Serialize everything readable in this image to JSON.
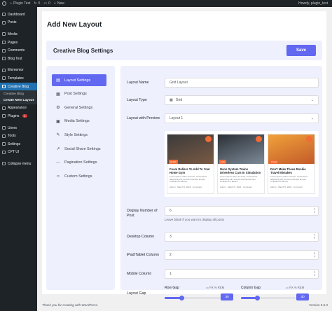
{
  "admin_bar": {
    "site_name": "Plugin Test",
    "updates": "5",
    "comments": "0",
    "new_label": "New",
    "greeting": "Howdy, plugin_test"
  },
  "sidebar": {
    "items": [
      {
        "label": "Dashboard",
        "icon": "dashboard-icon"
      },
      {
        "label": "Posts",
        "icon": "pin-icon"
      },
      {
        "label": "Media",
        "icon": "media-icon"
      },
      {
        "label": "Pages",
        "icon": "page-icon"
      },
      {
        "label": "Comments",
        "icon": "comment-icon"
      },
      {
        "label": "Blog Test",
        "icon": "pin-icon"
      },
      {
        "label": "Elementor",
        "icon": "elementor-icon"
      },
      {
        "label": "Templates",
        "icon": "folder-icon"
      },
      {
        "label": "Creative Blog",
        "icon": "blog-icon",
        "active": true
      }
    ],
    "submenu": [
      "Creative Blog",
      "Create New Layout"
    ],
    "items_after": [
      {
        "label": "Appearance",
        "icon": "brush-icon"
      },
      {
        "label": "Plugins",
        "icon": "plugin-icon",
        "badge": "1"
      },
      {
        "label": "Users",
        "icon": "user-icon"
      },
      {
        "label": "Tools",
        "icon": "wrench-icon"
      },
      {
        "label": "Settings",
        "icon": "settings-icon"
      },
      {
        "label": "CPT UI",
        "icon": "cpt-icon"
      },
      {
        "label": "Collapse menu",
        "icon": "collapse-icon"
      }
    ]
  },
  "page": {
    "title": "Add New Layout"
  },
  "header": {
    "title": "Creative Blog Settings",
    "save_label": "Save"
  },
  "tabs": [
    {
      "label": "Layout Settings",
      "icon": "layout-icon",
      "active": true
    },
    {
      "label": "Post Settings",
      "icon": "grid-icon"
    },
    {
      "label": "General Settings",
      "icon": "gear-icon"
    },
    {
      "label": "Media Settings",
      "icon": "media-icon"
    },
    {
      "label": "Style Settings",
      "icon": "brush-icon"
    },
    {
      "label": "Social Share Settings",
      "icon": "share-icon"
    },
    {
      "label": "Pagination Settings",
      "icon": "dots-icon"
    },
    {
      "label": "Custom Settings",
      "icon": "code-icon"
    }
  ],
  "form": {
    "layout_name": {
      "label": "Layout Name",
      "placeholder": "Grid Layout"
    },
    "layout_type": {
      "label": "Layout Type",
      "value": "Grid"
    },
    "layout_preview": {
      "label": "Layout with Preview",
      "value": "Layout 1"
    },
    "display_number": {
      "label": "Display Number of Post",
      "value": "6",
      "hint": "Leave blank if you want to display all posts"
    },
    "desktop_column": {
      "label": "Desktop Column",
      "value": "3"
    },
    "tablet_column": {
      "label": "iPad/Tablet Column",
      "value": "2"
    },
    "mobile_column": {
      "label": "Mobile Column",
      "value": "1"
    },
    "layout_gap": {
      "label": "Layout Gap"
    },
    "row_gap": {
      "label": "Row Gap",
      "value": "30",
      "units": "PX % REM",
      "fraction": 0.3
    },
    "column_gap": {
      "label": "Column Gap",
      "value": "30",
      "units": "PX % REM",
      "fraction": 0.3
    }
  },
  "preview_cards": [
    {
      "title": "Foam Rollers To Add To Your Home Gym",
      "category": "Health",
      "excerpt": "Lorem ipsum dolor sit amet, consectetur adipiscing elit, sed do eiusmod tempor incididunt ut labore.",
      "meta": [
        "Admin",
        "March 5, 2024",
        "Comment"
      ],
      "colors": [
        "#3a3a3a",
        "#7a5a44"
      ]
    },
    {
      "title": "Nano System Trains Driverless Cars In Simulation",
      "category": "Auto",
      "excerpt": "Lorem ipsum dolor sit amet, consectetur adipiscing elit, sed do eiusmod tempor incididunt ut labore.",
      "meta": [
        "Admin",
        "March 5, 2024",
        "Comment"
      ],
      "colors": [
        "#2b2f35",
        "#7d8b98"
      ]
    },
    {
      "title": "Don't Make These Rookie Travel Mistakes",
      "category": "Travel",
      "excerpt": "Lorem ipsum dolor sit amet, consectetur adipiscing elit, sed do eiusmod tempor incididunt ut labore.",
      "meta": [
        "Admin",
        "March 5, 2024",
        "Comment"
      ],
      "colors": [
        "#f0a23a",
        "#c35a2a"
      ]
    }
  ],
  "footer": {
    "thanks": "Thank you for creating with WordPress.",
    "version": "Version 6.5.3"
  }
}
